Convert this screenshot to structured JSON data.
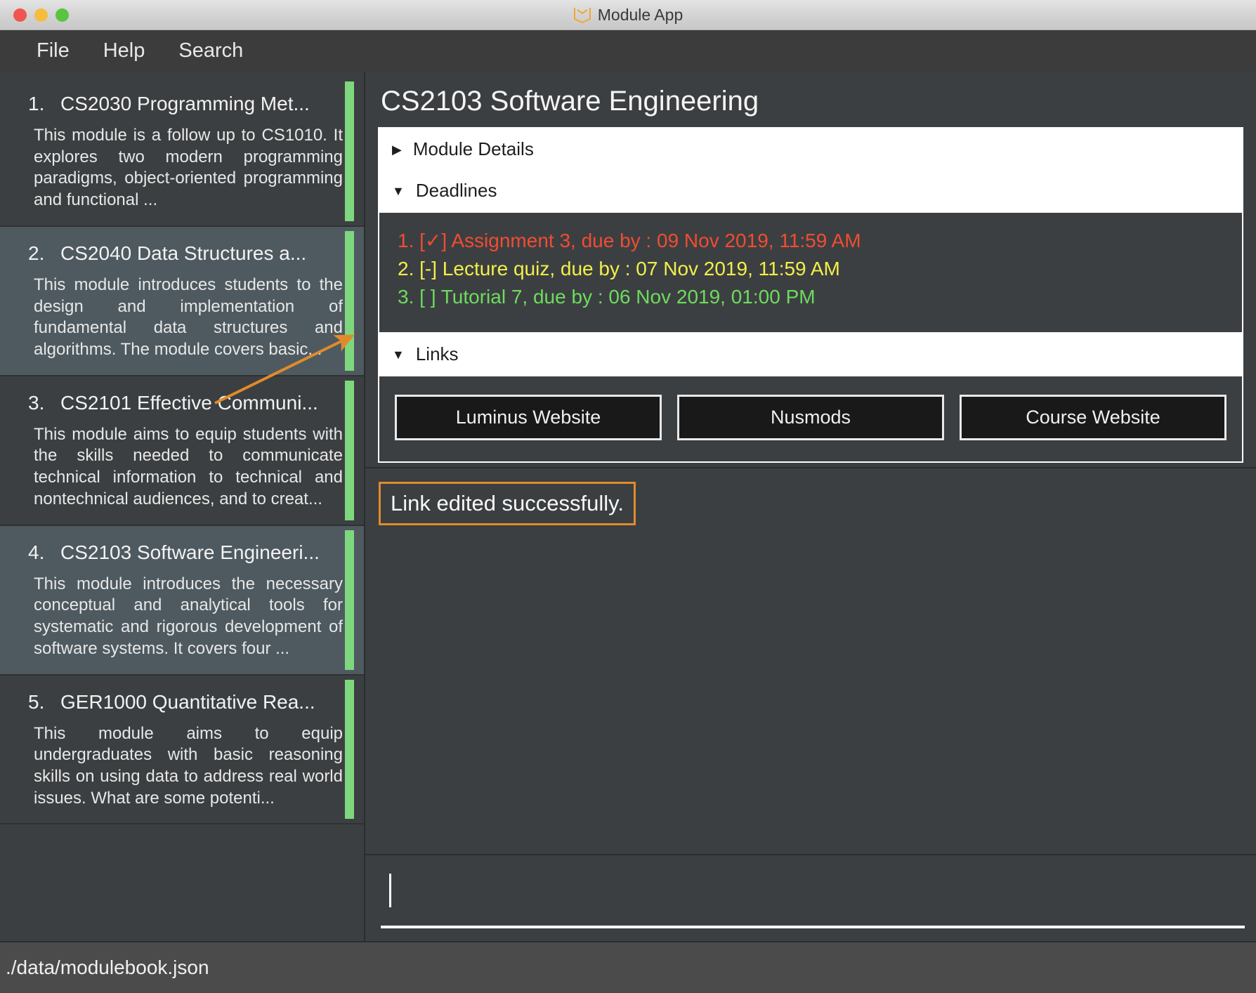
{
  "window": {
    "title": "Module App",
    "app_icon": "book-icon",
    "traffic_lights": [
      "close-red",
      "minimize-yellow",
      "maximize-green"
    ]
  },
  "menubar": {
    "items": [
      {
        "label": "File",
        "name": "menu-file"
      },
      {
        "label": "Help",
        "name": "menu-help"
      },
      {
        "label": "Search",
        "name": "menu-search"
      }
    ]
  },
  "sidebar": {
    "modules": [
      {
        "index": "1.",
        "title": "CS2030 Programming Met...",
        "description": "This module is a follow up to CS1010. It explores two modern programming paradigms, object-oriented programming and functional ..."
      },
      {
        "index": "2.",
        "title": "CS2040 Data Structures a...",
        "description": "This module introduces students to the design and implementation of fundamental data structures and algorithms. The module covers basic..."
      },
      {
        "index": "3.",
        "title": "CS2101 Effective Communi...",
        "description": "This module aims to equip students with the skills needed to communicate technical information to technical and nontechnical audiences, and to creat..."
      },
      {
        "index": "4.",
        "title": "CS2103 Software Engineeri...",
        "description": "This module introduces the necessary conceptual and analytical tools for systematic and rigorous development of software systems. It covers four ..."
      },
      {
        "index": "5.",
        "title": "GER1000 Quantitative Rea...",
        "description": "This module aims to equip undergraduates with basic reasoning skills on using data to address real world issues. What are some potenti..."
      }
    ]
  },
  "detail": {
    "module_title": "CS2103 Software Engineering",
    "sections": {
      "module_details": {
        "label": "Module Details",
        "expanded": false,
        "triangle": "▶"
      },
      "deadlines": {
        "label": "Deadlines",
        "expanded": true,
        "triangle": "▼"
      },
      "links": {
        "label": "Links",
        "expanded": true,
        "triangle": "▼"
      }
    },
    "deadlines": [
      {
        "text": "1. [✓] Assignment 3, due by : 09 Nov 2019, 11:59 AM",
        "color_key": "d-red"
      },
      {
        "text": "2. [-] Lecture quiz, due by : 07 Nov 2019, 11:59 AM",
        "color_key": "d-yellow"
      },
      {
        "text": "3. [ ] Tutorial 7, due by : 06 Nov 2019, 01:00 PM",
        "color_key": "d-green"
      }
    ],
    "links": [
      {
        "label": "Luminus Website",
        "name": "link-button-luminus"
      },
      {
        "label": "Nusmods",
        "name": "link-button-nusmods"
      },
      {
        "label": "Course Website",
        "name": "link-button-course"
      }
    ]
  },
  "annotation": {
    "arrow_color": "#e08b2b",
    "points_to": "Nusmods"
  },
  "result": {
    "message": "Link edited successfully.",
    "highlight_color": "#e08b2b"
  },
  "command": {
    "value": "",
    "caret_visible": true
  },
  "statusbar": {
    "file_path": "./data/modulebook.json"
  },
  "colors": {
    "accent_green": "#7ed77e",
    "deadline_red": "#f14c32",
    "deadline_yellow": "#f2ef49",
    "deadline_green": "#6edb5e",
    "annotation_orange": "#e08b2b",
    "panel_bg": "#3c3f41",
    "selected_row_bg": "#4e5a60"
  }
}
